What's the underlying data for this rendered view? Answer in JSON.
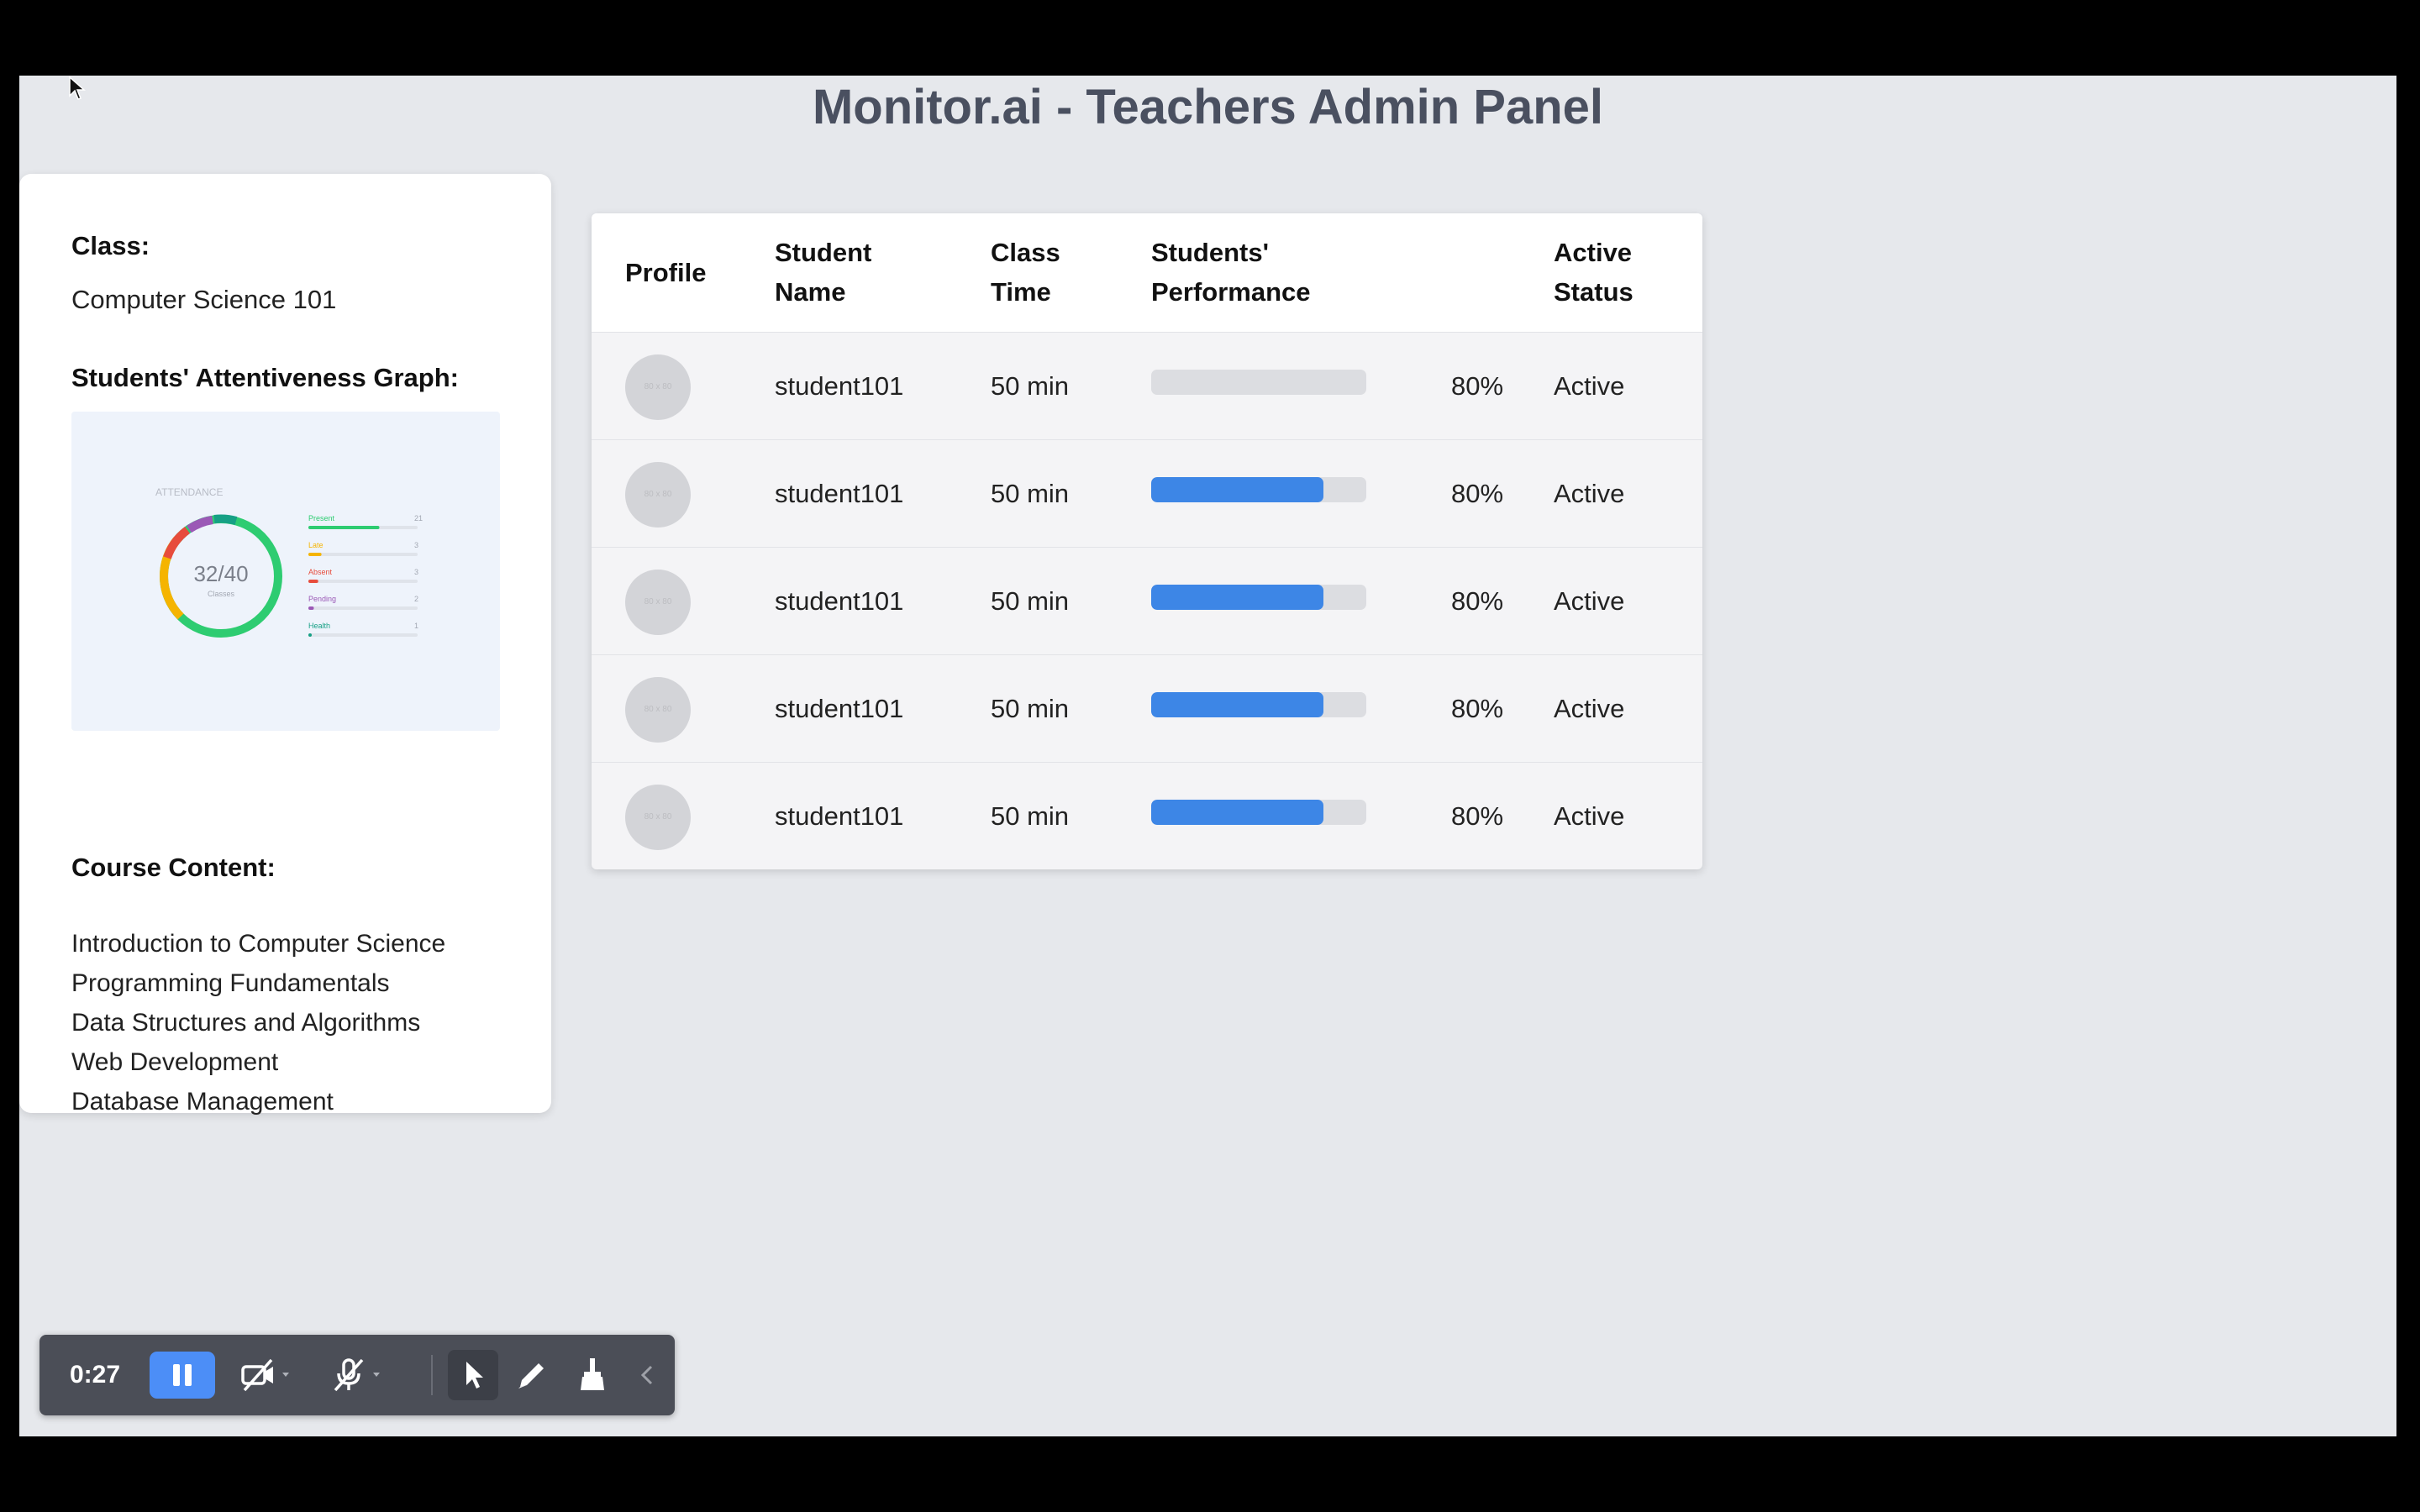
{
  "title": "Monitor.ai - Teachers Admin Panel",
  "sidebar": {
    "class_label": "Class:",
    "class_name": "Computer Science 101",
    "graph_label": "Students' Attentiveness Graph:",
    "graph": {
      "heading": "ATTENDANCE",
      "center_value": "32/40",
      "center_sub": "Classes",
      "legend": [
        {
          "label": "Present",
          "value": "21",
          "color": "#2ecc71",
          "fraction": 0.65
        },
        {
          "label": "Late",
          "value": "3",
          "color": "#f5b400",
          "fraction": 0.12
        },
        {
          "label": "Absent",
          "value": "3",
          "color": "#e74c3c",
          "fraction": 0.09
        },
        {
          "label": "Pending",
          "value": "2",
          "color": "#9b59b6",
          "fraction": 0.05
        },
        {
          "label": "Health",
          "value": "1",
          "color": "#16a085",
          "fraction": 0.03
        }
      ]
    },
    "course_label": "Course Content:",
    "courses": [
      "Introduction to Computer Science",
      "Programming Fundamentals",
      "Data Structures and Algorithms",
      "Web Development",
      "Database Management"
    ]
  },
  "table": {
    "headers": {
      "profile": "Profile",
      "name_1": "Student",
      "name_2": "Name",
      "time_1": "Class",
      "time_2": "Time",
      "perf_1": "Students'",
      "perf_2": "Performance",
      "status_1": "Active",
      "status_2": "Status"
    },
    "avatar_placeholder": "80 x 80",
    "rows": [
      {
        "name": "student101",
        "time": "50 min",
        "performance_fill": 0.0,
        "performance": "80%",
        "status": "Active"
      },
      {
        "name": "student101",
        "time": "50 min",
        "performance_fill": 0.8,
        "performance": "80%",
        "status": "Active"
      },
      {
        "name": "student101",
        "time": "50 min",
        "performance_fill": 0.8,
        "performance": "80%",
        "status": "Active"
      },
      {
        "name": "student101",
        "time": "50 min",
        "performance_fill": 0.8,
        "performance": "80%",
        "status": "Active"
      },
      {
        "name": "student101",
        "time": "50 min",
        "performance_fill": 0.8,
        "performance": "80%",
        "status": "Active"
      }
    ]
  },
  "toolbar": {
    "timer": "0:27",
    "icons": [
      "pause-icon",
      "camera-off-icon",
      "mic-off-icon",
      "pointer-icon",
      "pen-icon",
      "broom-icon",
      "collapse-chevron-icon"
    ]
  },
  "colors": {
    "accent": "#3d86e6",
    "background": "#e6e8ec",
    "title": "#4a5060"
  }
}
